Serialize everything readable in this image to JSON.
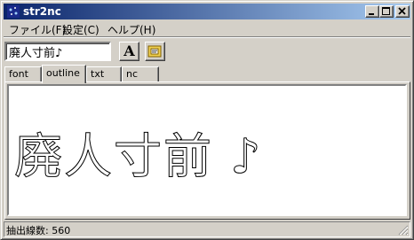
{
  "window": {
    "title": "str2nc"
  },
  "menu": [
    {
      "label": "ファイル(F)"
    },
    {
      "label": "設定(C)"
    },
    {
      "label": "ヘルプ(H)"
    }
  ],
  "toolbar": {
    "input_value": "廃人寸前♪",
    "font_button_label": "A"
  },
  "tabs": [
    {
      "label": "font"
    },
    {
      "label": "outline"
    },
    {
      "label": "txt"
    },
    {
      "label": "nc"
    }
  ],
  "active_tab": "outline",
  "canvas": {
    "outline_text": "廃人寸前 ♪"
  },
  "status": {
    "text": "抽出線数: 560"
  },
  "colors": {
    "titlebar_start": "#0a246a",
    "titlebar_end": "#a6caf0",
    "face": "#d4d0c8",
    "canvas_bg": "#ffffff"
  },
  "icons": [
    "app-icon",
    "minimize-icon",
    "maximize-icon",
    "close-icon",
    "font-icon",
    "export-icon",
    "resize-grip-icon"
  ]
}
